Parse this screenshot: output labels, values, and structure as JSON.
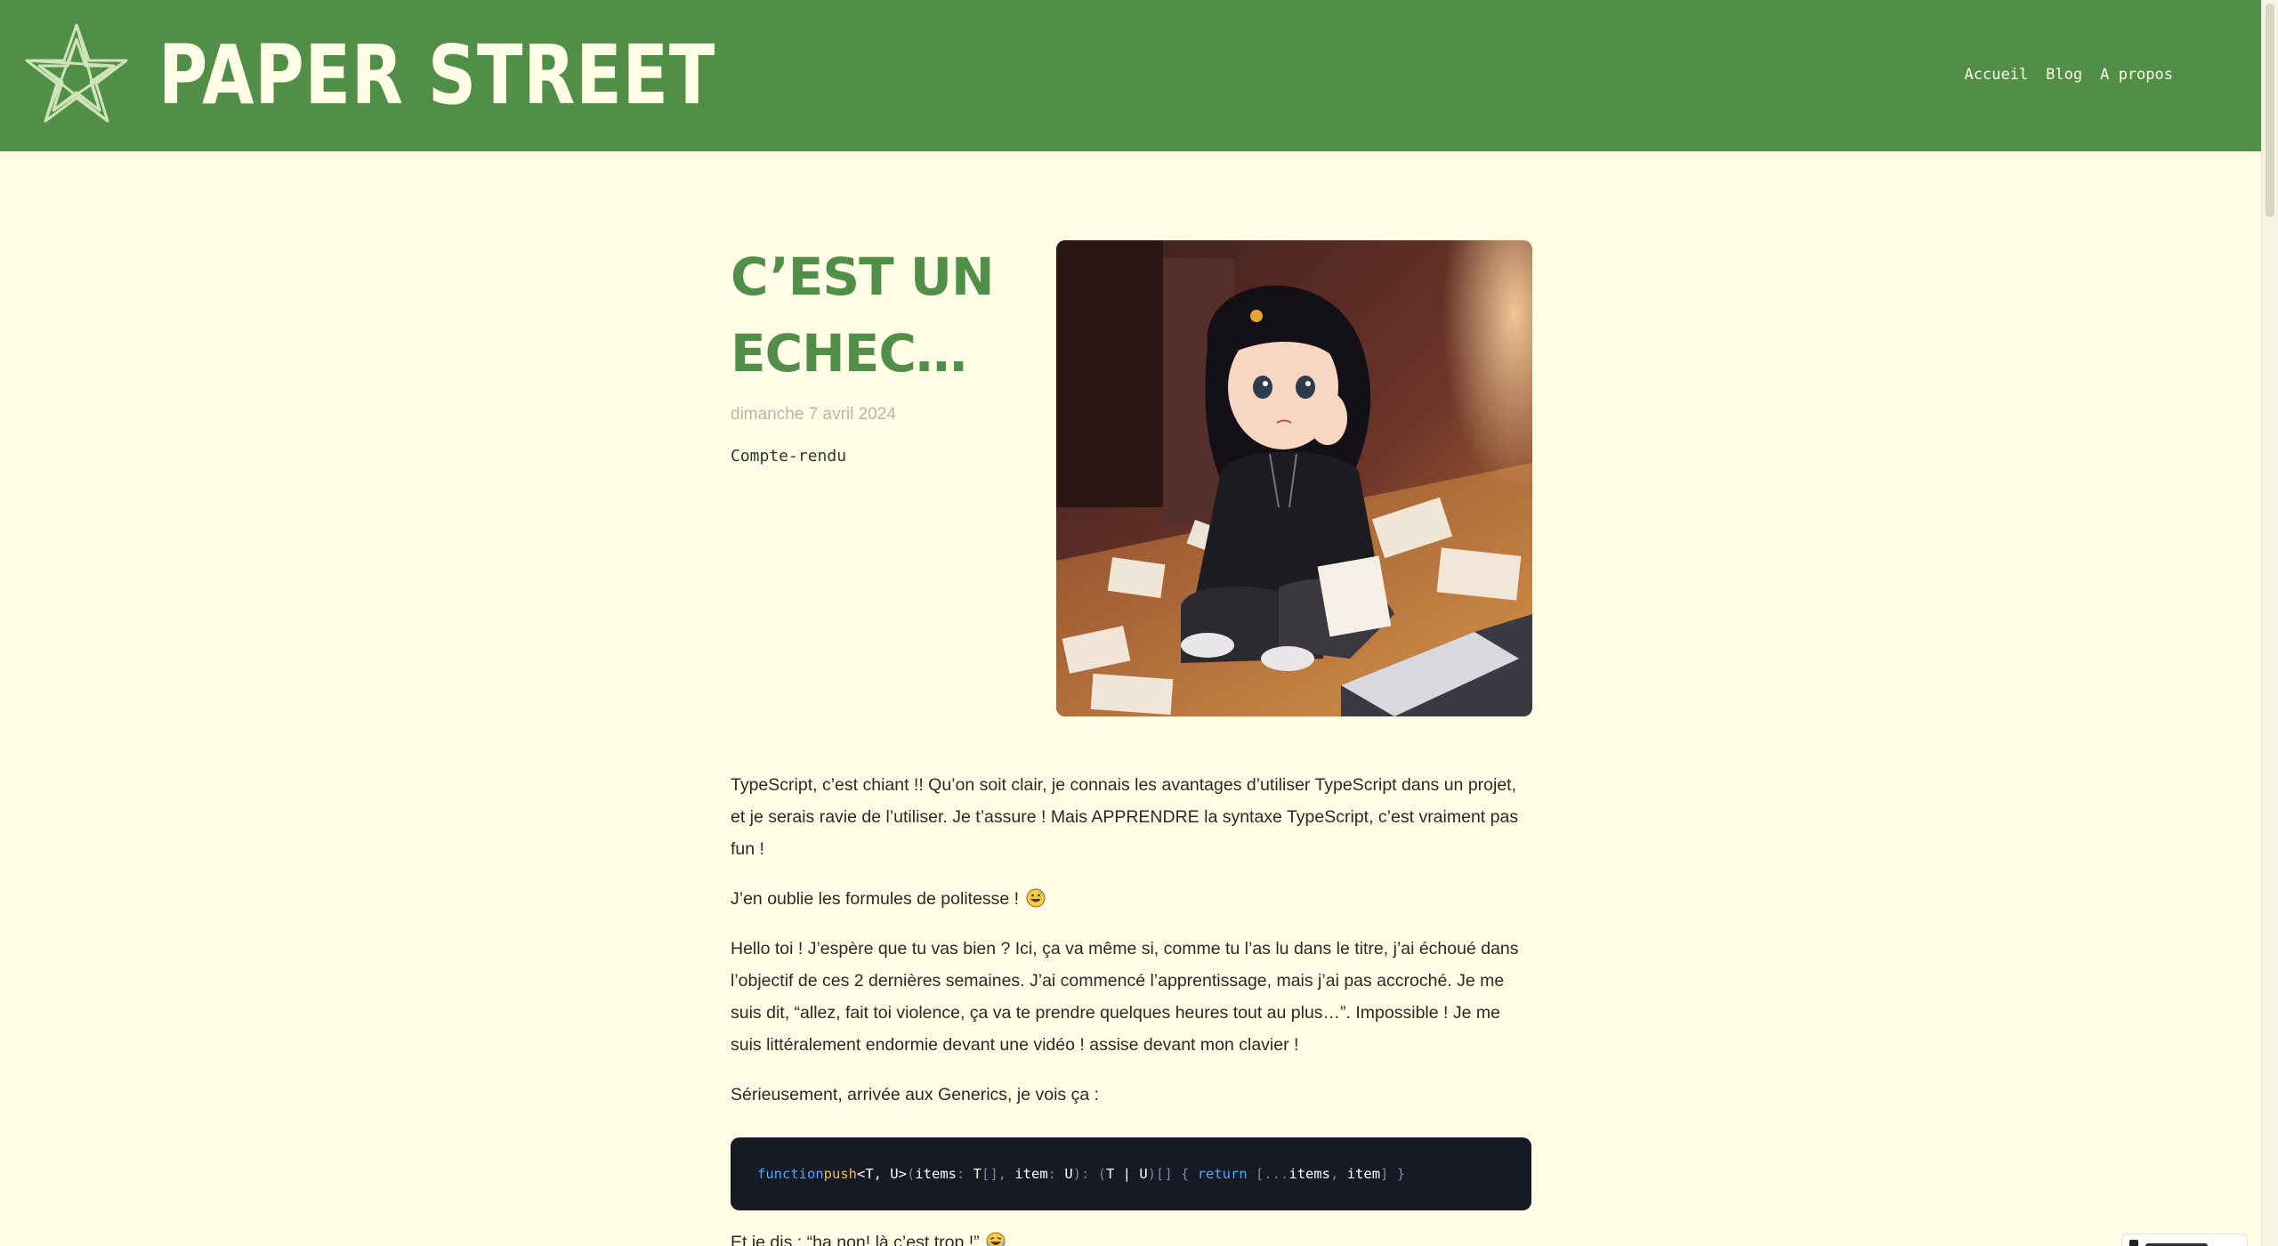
{
  "header": {
    "site_title": "PAPER STREET",
    "logo_icon": "star-logo-icon",
    "nav": [
      {
        "label": "Accueil"
      },
      {
        "label": "Blog"
      },
      {
        "label": "A propos"
      }
    ]
  },
  "post": {
    "title": "C’est un echec…",
    "date": "dimanche 7 avril 2024",
    "tag": "Compte-rendu",
    "hero_image": "anime-girl-sitting-on-floor-with-papers-illustration"
  },
  "content": {
    "p1": "TypeScript, c’est chiant !! Qu’on soit clair, je connais les avantages d’utiliser TypeScript dans un projet, et je serais ravie de l’utiliser. Je t’assure ! Mais APPRENDRE la syntaxe TypeScript, c’est vraiment pas fun !",
    "p2": "J’en oublie les formules de politesse ! ",
    "p3": "Hello toi ! J’espère que tu vas bien ? Ici, ça va même si, comme tu l’as lu dans le titre, j’ai échoué dans l’objectif de ces 2 dernières semaines. J’ai commencé l’apprentissage, mais j’ai pas accroché. Je me suis dit, “allez, fait toi violence, ça va te prendre quelques heures tout au plus…”. Impossible ! Je me suis littéralement endormie devant une vidéo ! assise devant mon clavier !",
    "p4": "Sérieusement, arrivée aux Generics, je vois ça :",
    "code": {
      "kw_function": "function",
      "fn_name": "push",
      "generics": "<T, U>",
      "open_paren": "(",
      "param1": "items",
      "colon1": ": ",
      "type1": "T",
      "brackets1": "[], ",
      "param2": "item",
      "colon2": ": ",
      "type2": "U",
      "close_paren": "): (",
      "union": "T | U",
      "ret_close": ")[] { ",
      "kw_return": "return",
      "spread_open": " [...",
      "items_ref": "items",
      "comma": ", ",
      "item_ref": "item",
      "end": "] }"
    },
    "p5": "Et je dis : “ha non! là c’est trop !” ",
    "emoji_1": "grinning-sweat-emoji-icon",
    "emoji_2": "laughing-tears-emoji-icon"
  },
  "colors": {
    "header_green": "#518f48",
    "page_background": "#fffde6",
    "title_green": "#518f48",
    "code_background": "#151a25",
    "code_keyword": "#4aa8ff",
    "code_function": "#f5b94a"
  }
}
